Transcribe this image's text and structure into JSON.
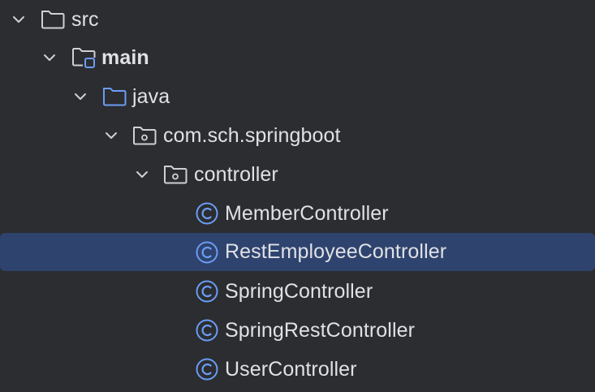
{
  "colors": {
    "background": "#2b2d30",
    "selection": "#2e436e",
    "text": "#dfe1e5",
    "folder_icon": "#ced0d6",
    "java_folder_icon": "#6c9cf5",
    "class_icon": "#6c9cf5"
  },
  "tree": {
    "src": {
      "label": "src",
      "icon": "folder-icon"
    },
    "main": {
      "label": "main",
      "icon": "module-folder-icon"
    },
    "java": {
      "label": "java",
      "icon": "source-folder-icon"
    },
    "package": {
      "label": "com.sch.springboot",
      "icon": "package-icon"
    },
    "controller": {
      "label": "controller",
      "icon": "package-icon"
    },
    "classes": [
      {
        "label": "MemberController",
        "icon": "class-icon",
        "selected": false
      },
      {
        "label": "RestEmployeeController",
        "icon": "class-icon",
        "selected": true
      },
      {
        "label": "SpringController",
        "icon": "class-icon",
        "selected": false
      },
      {
        "label": "SpringRestController",
        "icon": "class-icon",
        "selected": false
      },
      {
        "label": "UserController",
        "icon": "class-icon",
        "selected": false
      }
    ]
  }
}
